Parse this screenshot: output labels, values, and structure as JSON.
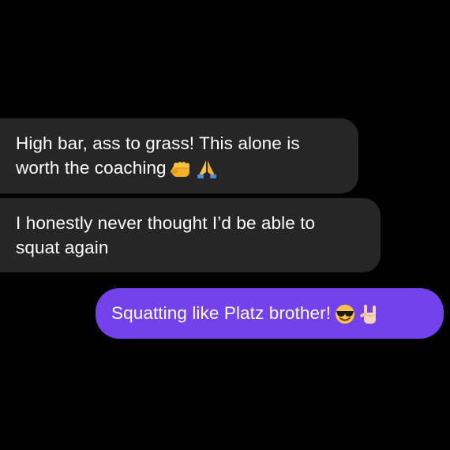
{
  "messages": [
    {
      "direction": "incoming",
      "lines": [
        "High bar, ass to grass! This alone is",
        "worth the coaching"
      ],
      "emojis": [
        "fist-bump-icon",
        "praying-hands-icon"
      ]
    },
    {
      "direction": "incoming",
      "lines": [
        "I honestly never thought I’d be able to",
        "squat again"
      ],
      "emojis": []
    },
    {
      "direction": "outgoing",
      "lines": [
        "Squatting like Platz brother!"
      ],
      "emojis": [
        "sunglasses-face-icon",
        "rock-on-hand-icon"
      ]
    }
  ],
  "colors": {
    "background": "#000000",
    "incoming_bubble": "#262626",
    "outgoing_bubble": "#7342ec",
    "text": "#ffffff"
  }
}
